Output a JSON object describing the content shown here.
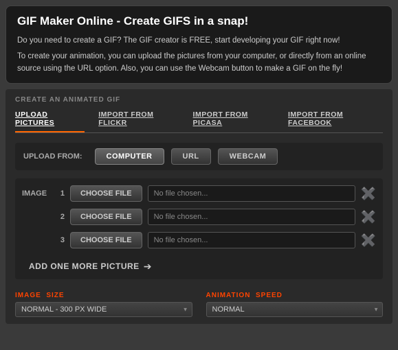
{
  "header": {
    "title": "GIF Maker Online - Create GIFS in a snap!",
    "desc1": "Do you need to create a GIF? The GIF creator is FREE, start developing your GIF right now!",
    "desc2": "To create your animation, you can upload the pictures from your computer, or directly from an online source using the URL option. Also, you can use the Webcam button to make a GIF on the fly!"
  },
  "section": {
    "title": "CREATE AN ANIMATED GIF"
  },
  "tabs": [
    {
      "label": "UPLOAD PICTURES",
      "active": true
    },
    {
      "label": "IMPORT FROM FLICKR",
      "active": false
    },
    {
      "label": "IMPORT FROM PICASA",
      "active": false
    },
    {
      "label": "IMPORT FROM FACEBOOK",
      "active": false
    }
  ],
  "upload_from": {
    "label": "UPLOAD FROM:",
    "sources": [
      {
        "label": "COMPUTER",
        "active": true
      },
      {
        "label": "URL",
        "active": false
      },
      {
        "label": "WEBCAM",
        "active": false
      }
    ]
  },
  "images": {
    "label": "IMAGE",
    "rows": [
      {
        "num": "1",
        "placeholder": "No file chosen..."
      },
      {
        "num": "2",
        "placeholder": "No file chosen..."
      },
      {
        "num": "3",
        "placeholder": "No file chosen..."
      }
    ],
    "choose_btn": "CHOOSE FILE"
  },
  "add_more": {
    "label": "ADD ONE MORE PICTURE"
  },
  "image_size": {
    "label": "IMAGE",
    "label_colored": "SIZE",
    "value": "NORMAL - 300 PX WIDE"
  },
  "animation_speed": {
    "label": "ANIMATION",
    "label_colored": "SPEED",
    "value": "NORMAL"
  }
}
